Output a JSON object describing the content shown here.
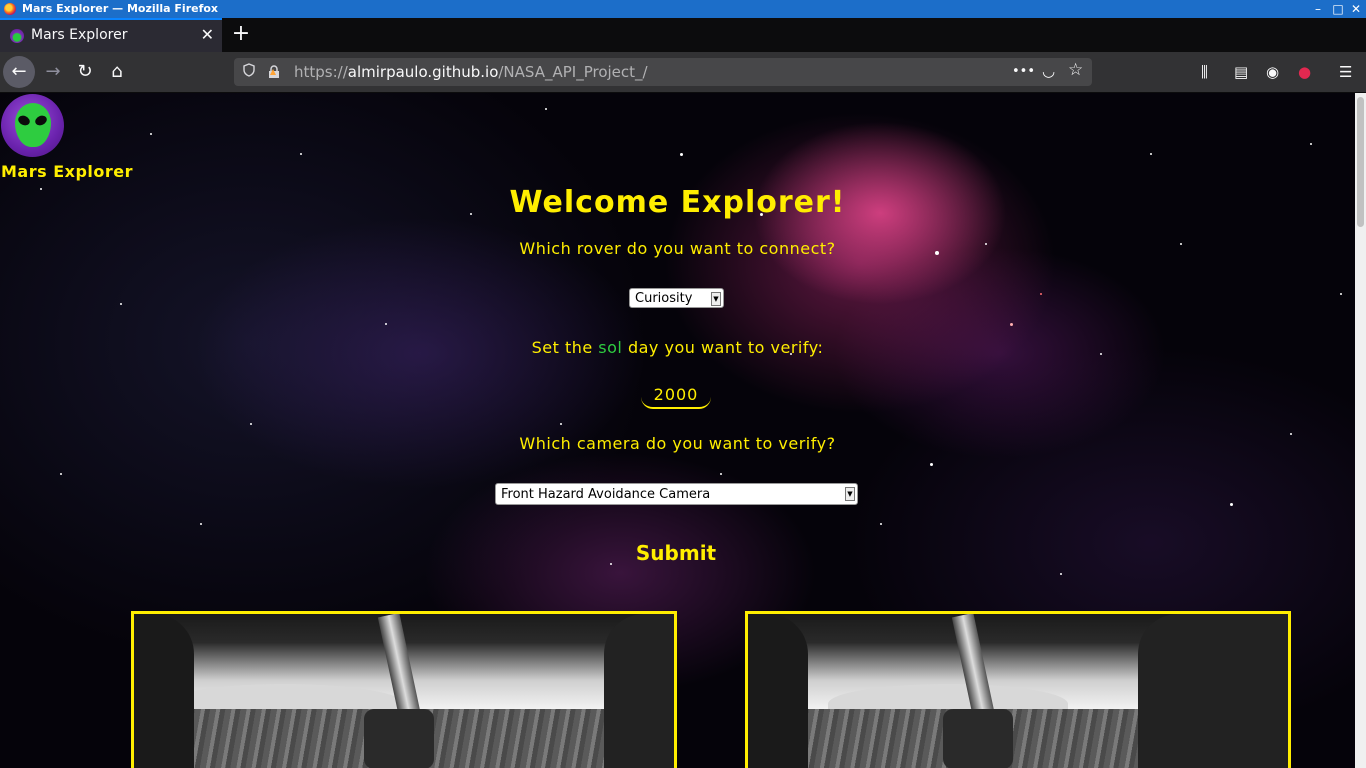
{
  "window": {
    "title": "Mars Explorer — Mozilla Firefox",
    "min_glyph": "–",
    "max_glyph": "□",
    "close_glyph": "✕"
  },
  "tab": {
    "label": "Mars Explorer",
    "close_glyph": "✕",
    "new_tab_glyph": "+"
  },
  "navbar": {
    "back_glyph": "←",
    "forward_glyph": "→",
    "reload_glyph": "↻",
    "home_glyph": "⌂",
    "url_prefix": "https://",
    "url_host": "almirpaulo.github.io",
    "url_path": "/NASA_API_Project_/",
    "page_actions_glyph": "•••",
    "pocket_glyph": "◡",
    "bookmark_glyph": "☆",
    "library_glyph": "⫼",
    "sidebar_glyph": "▤",
    "account_glyph": "◉",
    "extension_glyph": "●",
    "menu_glyph": "☰"
  },
  "page": {
    "brand": "Mars Explorer",
    "title": "Welcome Explorer!",
    "rover_question": "Which rover do you want to connect?",
    "rover_selected": "Curiosity",
    "sol_question_pre": "Set the ",
    "sol_question_word": "sol",
    "sol_question_post": " day you want to verify:",
    "sol_value": "2000",
    "camera_question": "Which camera do you want to verify?",
    "camera_selected": "Front Hazard Avoidance Camera",
    "submit_label": "Submit"
  },
  "colors": {
    "accent_yellow": "#ffee00",
    "sol_green": "#2ecc40",
    "titlebar_blue": "#1c6ec9"
  }
}
